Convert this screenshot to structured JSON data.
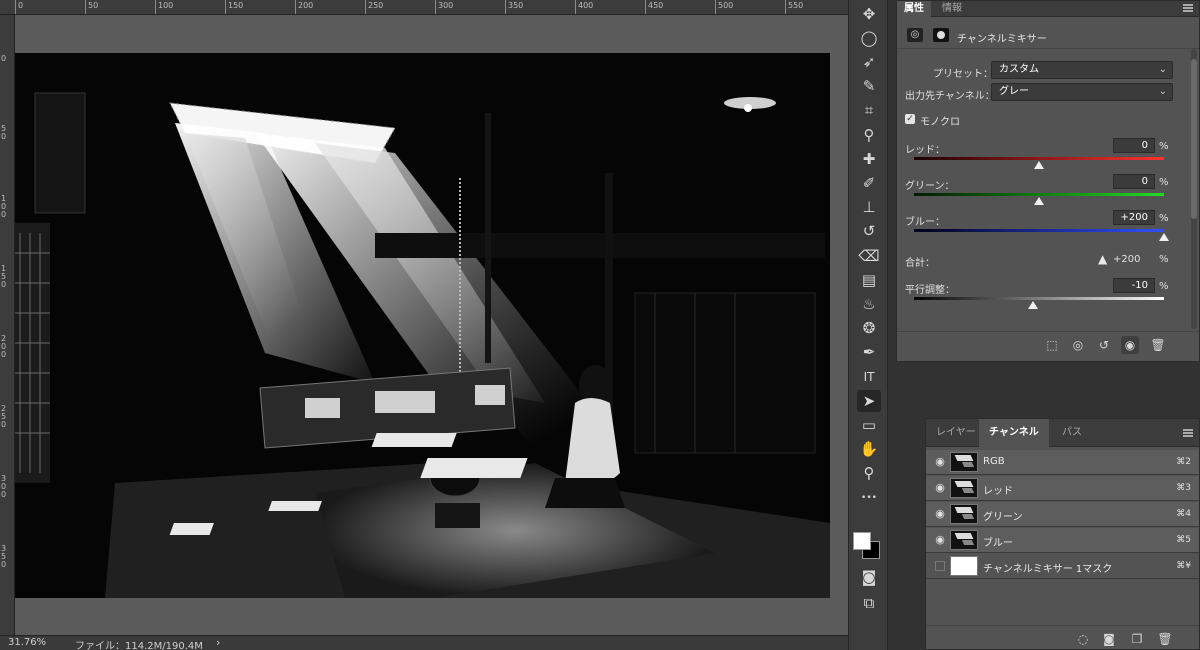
{
  "ruler": {
    "top_ticks": [
      "0",
      "50",
      "100",
      "150",
      "200",
      "250",
      "300",
      "350",
      "400",
      "450",
      "500",
      "550"
    ],
    "left_ticks": [
      "0",
      "50",
      "100",
      "150",
      "200",
      "250",
      "300",
      "350"
    ]
  },
  "status_bar": {
    "zoom": "31.76%",
    "file_info": "ファイル：114.2M/190.4M",
    "arrow": "›"
  },
  "toolbar": {
    "tools": [
      {
        "name": "move-tool",
        "icon": "move-icon",
        "glyph": "✥"
      },
      {
        "name": "marquee-tool",
        "icon": "ellipse-marquee-icon",
        "glyph": "◯"
      },
      {
        "name": "lasso-tool",
        "icon": "lasso-icon",
        "glyph": "➶"
      },
      {
        "name": "quick-select-tool",
        "icon": "quick-select-icon",
        "glyph": "✎"
      },
      {
        "name": "crop-tool",
        "icon": "crop-icon",
        "glyph": "⌗"
      },
      {
        "name": "eyedropper-tool",
        "icon": "eyedropper-icon",
        "glyph": "⚲"
      },
      {
        "name": "healing-tool",
        "icon": "bandage-icon",
        "glyph": "✚"
      },
      {
        "name": "brush-tool",
        "icon": "brush-icon",
        "glyph": "✐"
      },
      {
        "name": "stamp-tool",
        "icon": "stamp-icon",
        "glyph": "⊥"
      },
      {
        "name": "history-brush-tool",
        "icon": "history-brush-icon",
        "glyph": "↺"
      },
      {
        "name": "eraser-tool",
        "icon": "eraser-icon",
        "glyph": "⌫"
      },
      {
        "name": "gradient-tool",
        "icon": "gradient-icon",
        "glyph": "▤"
      },
      {
        "name": "blur-tool",
        "icon": "blur-drop-icon",
        "glyph": "♨"
      },
      {
        "name": "dodge-tool",
        "icon": "dodge-icon",
        "glyph": "❂"
      },
      {
        "name": "pen-tool",
        "icon": "pen-icon",
        "glyph": "✒"
      },
      {
        "name": "type-tool",
        "icon": "vertical-type-icon",
        "glyph": "IT"
      },
      {
        "name": "path-select-tool",
        "icon": "arrow-pointer-icon",
        "glyph": "➤"
      },
      {
        "name": "rectangle-tool",
        "icon": "rectangle-icon",
        "glyph": "▭"
      },
      {
        "name": "hand-tool",
        "icon": "hand-icon",
        "glyph": "✋"
      },
      {
        "name": "zoom-tool",
        "icon": "zoom-icon",
        "glyph": "⚲"
      },
      {
        "name": "more-tools",
        "icon": "ellipsis-icon",
        "glyph": "•••"
      }
    ],
    "quick_mask_glyph": "◙",
    "screen_mode_glyph": "⧉"
  },
  "properties": {
    "tabs": [
      "属性",
      "情報"
    ],
    "title": "チャンネルミキサー",
    "preset_label": "プリセット：",
    "preset_value": "カスタム",
    "output_label": "出力先チャンネル：",
    "output_value": "グレー",
    "monochrome_label": "モノクロ",
    "monochrome_checked": true,
    "sliders": [
      {
        "label": "レッド：",
        "value": "0",
        "pct": "%",
        "level": 0,
        "color": "red"
      },
      {
        "label": "グリーン：",
        "value": "0",
        "pct": "%",
        "level": 0,
        "color": "green"
      },
      {
        "label": "ブルー：",
        "value": "+200",
        "pct": "%",
        "level": 200,
        "color": "blue"
      }
    ],
    "total_label": "合計：",
    "total_value": "+200",
    "total_pct": "%",
    "constant_label": "平行調整：",
    "constant_value": "-10",
    "constant_pct": "%",
    "constant_level": -10
  },
  "channels": {
    "tabs": [
      "レイヤー",
      "チャンネル",
      "パス"
    ],
    "rows": [
      {
        "name": "RGB",
        "shortcut": "⌘2"
      },
      {
        "name": "レッド",
        "shortcut": "⌘3"
      },
      {
        "name": "グリーン",
        "shortcut": "⌘4"
      },
      {
        "name": "ブルー",
        "shortcut": "⌘5"
      },
      {
        "name": "チャンネルミキサー 1マスク",
        "shortcut": "⌘¥"
      }
    ]
  },
  "colors": {
    "fg": "#ffffff",
    "bg": "#000000"
  }
}
